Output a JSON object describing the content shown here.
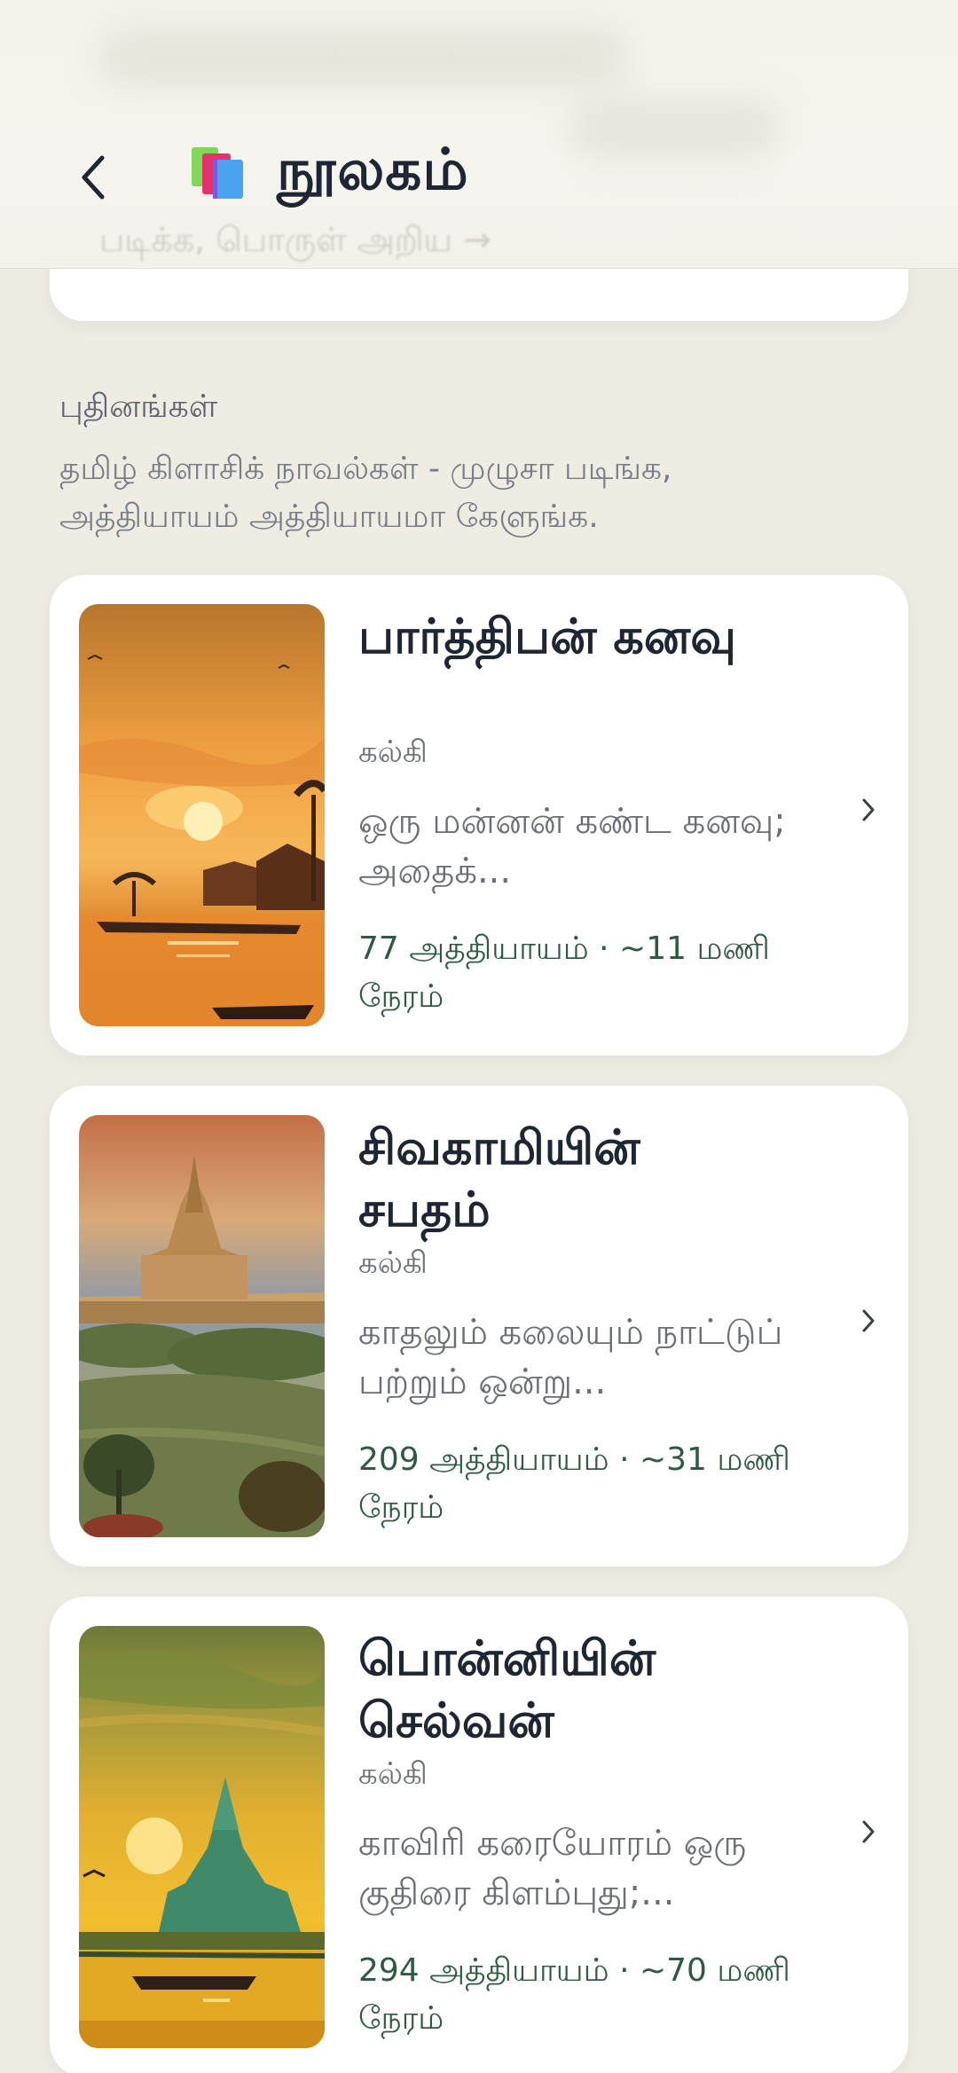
{
  "header": {
    "title": "நூலகம்",
    "back_icon": "back-chevron-icon",
    "app_icon": "books-icon",
    "ghost_text": "படிக்க, பொருள் அறிய →"
  },
  "section": {
    "title": "புதினங்கள்",
    "description": "தமிழ் கிளாசிக் நாவல்கள் - முழுசா படிங்க, அத்தியாயம் அத்தியாயமா கேளுங்க."
  },
  "books": [
    {
      "title": "பார்த்திபன் கனவு",
      "author": "கல்கி",
      "description": "ஒரு மன்னன் கண்ட கனவு; அதைக்...",
      "meta": "77 அத்தியாயம் · ~11 மணி நேரம்"
    },
    {
      "title": "சிவகாமியின் சபதம்",
      "author": "கல்கி",
      "description": "காதலும் கலையும் நாட்டுப் பற்றும் ஒன்று...",
      "meta": "209 அத்தியாயம் · ~31 மணி நேரம்"
    },
    {
      "title": "பொன்னியின் செல்வன்",
      "author": "கல்கி",
      "description": "காவிரி கரையோரம் ஒரு குதிரை கிளம்புது;...",
      "meta": "294 அத்தியாயம் · ~70 மணி நேரம்"
    }
  ],
  "colors": {
    "background": "#efede3",
    "card": "#ffffff",
    "title_text": "#1f2633",
    "meta_text": "#2f5a40"
  }
}
